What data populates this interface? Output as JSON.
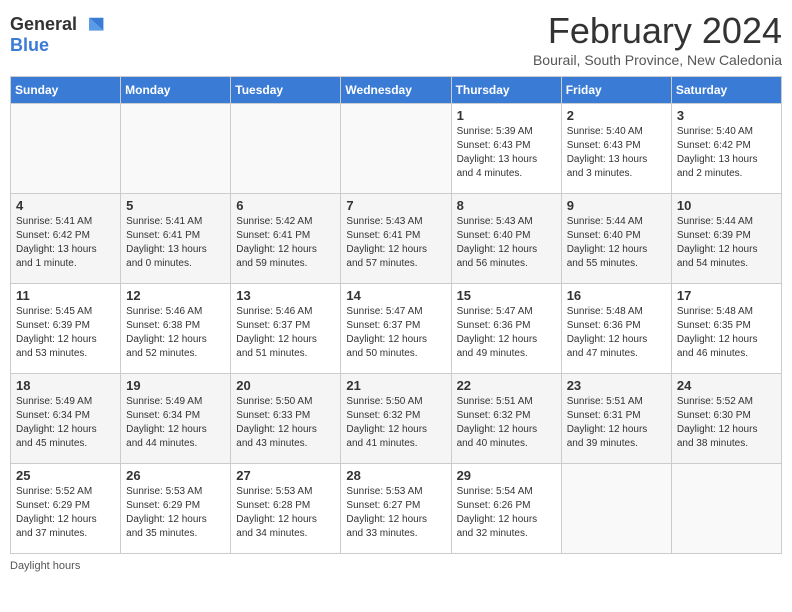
{
  "header": {
    "logo_general": "General",
    "logo_blue": "Blue",
    "month_title": "February 2024",
    "location": "Bourail, South Province, New Caledonia"
  },
  "days_of_week": [
    "Sunday",
    "Monday",
    "Tuesday",
    "Wednesday",
    "Thursday",
    "Friday",
    "Saturday"
  ],
  "weeks": [
    [
      {
        "day": "",
        "info": ""
      },
      {
        "day": "",
        "info": ""
      },
      {
        "day": "",
        "info": ""
      },
      {
        "day": "",
        "info": ""
      },
      {
        "day": "1",
        "info": "Sunrise: 5:39 AM\nSunset: 6:43 PM\nDaylight: 13 hours\nand 4 minutes."
      },
      {
        "day": "2",
        "info": "Sunrise: 5:40 AM\nSunset: 6:43 PM\nDaylight: 13 hours\nand 3 minutes."
      },
      {
        "day": "3",
        "info": "Sunrise: 5:40 AM\nSunset: 6:42 PM\nDaylight: 13 hours\nand 2 minutes."
      }
    ],
    [
      {
        "day": "4",
        "info": "Sunrise: 5:41 AM\nSunset: 6:42 PM\nDaylight: 13 hours\nand 1 minute."
      },
      {
        "day": "5",
        "info": "Sunrise: 5:41 AM\nSunset: 6:41 PM\nDaylight: 13 hours\nand 0 minutes."
      },
      {
        "day": "6",
        "info": "Sunrise: 5:42 AM\nSunset: 6:41 PM\nDaylight: 12 hours\nand 59 minutes."
      },
      {
        "day": "7",
        "info": "Sunrise: 5:43 AM\nSunset: 6:41 PM\nDaylight: 12 hours\nand 57 minutes."
      },
      {
        "day": "8",
        "info": "Sunrise: 5:43 AM\nSunset: 6:40 PM\nDaylight: 12 hours\nand 56 minutes."
      },
      {
        "day": "9",
        "info": "Sunrise: 5:44 AM\nSunset: 6:40 PM\nDaylight: 12 hours\nand 55 minutes."
      },
      {
        "day": "10",
        "info": "Sunrise: 5:44 AM\nSunset: 6:39 PM\nDaylight: 12 hours\nand 54 minutes."
      }
    ],
    [
      {
        "day": "11",
        "info": "Sunrise: 5:45 AM\nSunset: 6:39 PM\nDaylight: 12 hours\nand 53 minutes."
      },
      {
        "day": "12",
        "info": "Sunrise: 5:46 AM\nSunset: 6:38 PM\nDaylight: 12 hours\nand 52 minutes."
      },
      {
        "day": "13",
        "info": "Sunrise: 5:46 AM\nSunset: 6:37 PM\nDaylight: 12 hours\nand 51 minutes."
      },
      {
        "day": "14",
        "info": "Sunrise: 5:47 AM\nSunset: 6:37 PM\nDaylight: 12 hours\nand 50 minutes."
      },
      {
        "day": "15",
        "info": "Sunrise: 5:47 AM\nSunset: 6:36 PM\nDaylight: 12 hours\nand 49 minutes."
      },
      {
        "day": "16",
        "info": "Sunrise: 5:48 AM\nSunset: 6:36 PM\nDaylight: 12 hours\nand 47 minutes."
      },
      {
        "day": "17",
        "info": "Sunrise: 5:48 AM\nSunset: 6:35 PM\nDaylight: 12 hours\nand 46 minutes."
      }
    ],
    [
      {
        "day": "18",
        "info": "Sunrise: 5:49 AM\nSunset: 6:34 PM\nDaylight: 12 hours\nand 45 minutes."
      },
      {
        "day": "19",
        "info": "Sunrise: 5:49 AM\nSunset: 6:34 PM\nDaylight: 12 hours\nand 44 minutes."
      },
      {
        "day": "20",
        "info": "Sunrise: 5:50 AM\nSunset: 6:33 PM\nDaylight: 12 hours\nand 43 minutes."
      },
      {
        "day": "21",
        "info": "Sunrise: 5:50 AM\nSunset: 6:32 PM\nDaylight: 12 hours\nand 41 minutes."
      },
      {
        "day": "22",
        "info": "Sunrise: 5:51 AM\nSunset: 6:32 PM\nDaylight: 12 hours\nand 40 minutes."
      },
      {
        "day": "23",
        "info": "Sunrise: 5:51 AM\nSunset: 6:31 PM\nDaylight: 12 hours\nand 39 minutes."
      },
      {
        "day": "24",
        "info": "Sunrise: 5:52 AM\nSunset: 6:30 PM\nDaylight: 12 hours\nand 38 minutes."
      }
    ],
    [
      {
        "day": "25",
        "info": "Sunrise: 5:52 AM\nSunset: 6:29 PM\nDaylight: 12 hours\nand 37 minutes."
      },
      {
        "day": "26",
        "info": "Sunrise: 5:53 AM\nSunset: 6:29 PM\nDaylight: 12 hours\nand 35 minutes."
      },
      {
        "day": "27",
        "info": "Sunrise: 5:53 AM\nSunset: 6:28 PM\nDaylight: 12 hours\nand 34 minutes."
      },
      {
        "day": "28",
        "info": "Sunrise: 5:53 AM\nSunset: 6:27 PM\nDaylight: 12 hours\nand 33 minutes."
      },
      {
        "day": "29",
        "info": "Sunrise: 5:54 AM\nSunset: 6:26 PM\nDaylight: 12 hours\nand 32 minutes."
      },
      {
        "day": "",
        "info": ""
      },
      {
        "day": "",
        "info": ""
      }
    ]
  ],
  "footer": "Daylight hours"
}
